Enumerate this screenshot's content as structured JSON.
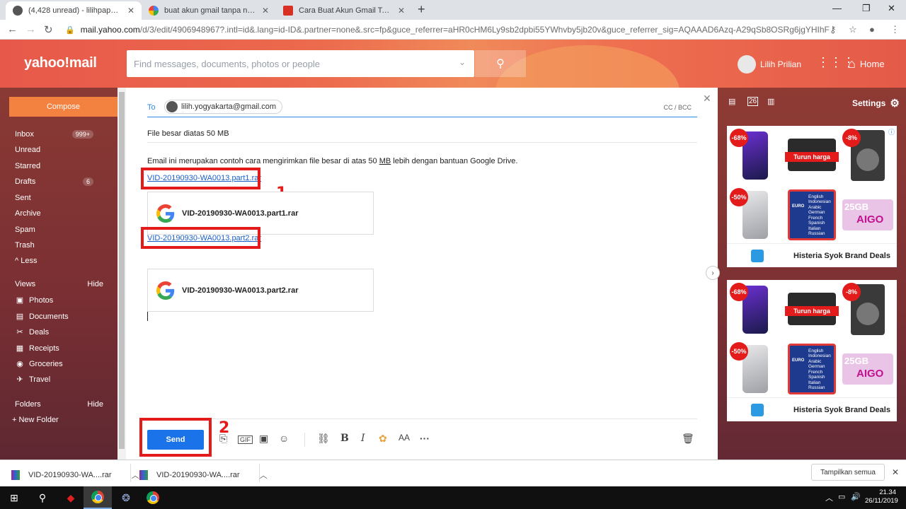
{
  "browser": {
    "tabs": [
      {
        "title": "(4,428 unread) - lilihpap@yahoo.c",
        "active": true
      },
      {
        "title": "buat akun gmail tanpa no hp - P",
        "active": false
      },
      {
        "title": "Cara Buat Akun Gmail Tanpa No",
        "active": false
      }
    ],
    "url_host": "mail.yahoo.com",
    "url_path": "/d/3/edit/4906948967?.intl=id&.lang=id-ID&.partner=none&.src=fp&guce_referrer=aHR0cHM6Ly9sb2dpbi55YWhvby5jb20v&guce_referrer_sig=AQAAAD6Azq-A29qSb8OSRg6jgYHIhFH6YDNkvn..."
  },
  "header": {
    "logo": "yahoo!mail",
    "search_placeholder": "Find messages, documents, photos or people",
    "user_name": "Lilih Prilian",
    "home_label": "Home"
  },
  "sidebar": {
    "compose_label": "Compose",
    "items": [
      {
        "label": "Inbox",
        "badge": "999+"
      },
      {
        "label": "Unread",
        "badge": ""
      },
      {
        "label": "Starred",
        "badge": ""
      },
      {
        "label": "Drafts",
        "badge": "6"
      },
      {
        "label": "Sent",
        "badge": ""
      },
      {
        "label": "Archive",
        "badge": ""
      },
      {
        "label": "Spam",
        "badge": ""
      },
      {
        "label": "Trash",
        "badge": ""
      },
      {
        "label": "Less",
        "badge": ""
      }
    ],
    "views_label": "Views",
    "views_hide": "Hide",
    "views": [
      {
        "label": "Photos",
        "icon": "photos-icon"
      },
      {
        "label": "Documents",
        "icon": "documents-icon"
      },
      {
        "label": "Deals",
        "icon": "deals-icon"
      },
      {
        "label": "Receipts",
        "icon": "receipts-icon"
      },
      {
        "label": "Groceries",
        "icon": "groceries-icon"
      },
      {
        "label": "Travel",
        "icon": "travel-icon"
      }
    ],
    "folders_label": "Folders",
    "folders_hide": "Hide",
    "new_folder": "+ New Folder"
  },
  "compose": {
    "to_label": "To",
    "recipient": "lilih.yogyakarta@gmail.com",
    "cc_bcc": "CC / BCC",
    "subject": "File besar diatas 50 MB",
    "body_pre": "Email ini merupakan contoh cara mengirimkan file besar di atas 50 ",
    "body_mb": "MB",
    "body_post": " lebih dengan bantuan Google Drive.",
    "link1": "VID-20190930-WA0013.part1.rar",
    "card1": "VID-20190930-WA0013.part1.rar",
    "link2": "VID-20190930-WA0013.part2.rar",
    "card2": "VID-20190930-WA0013.part2.rar",
    "send_label": "Send",
    "annotation_1": "1",
    "annotation_2": "2"
  },
  "rail": {
    "settings_label": "Settings",
    "ads": [
      {
        "discount_1": "-68%",
        "promo": "Turun harga",
        "discount_2": "-8%",
        "discount_3": "-50%",
        "gb": "25GB",
        "aigo": "AIGO",
        "brand": "Histeria Syok Brand Deals",
        "book_title": "EURO",
        "book_lines": [
          "English",
          "Indonesian",
          "Arabic",
          "German",
          "French",
          "Spanish",
          "Italian",
          "Russian"
        ]
      },
      {
        "discount_1": "-68%",
        "promo": "Turun harga",
        "discount_2": "-8%",
        "discount_3": "-50%",
        "gb": "25GB",
        "aigo": "AIGO",
        "brand": "Histeria Syok Brand Deals",
        "book_title": "EURO",
        "book_lines": [
          "English",
          "Indonesian",
          "Arabic",
          "German",
          "French",
          "Spanish",
          "Italian",
          "Russian"
        ]
      }
    ]
  },
  "downloads": {
    "items": [
      "VID-20190930-WA....rar",
      "VID-20190930-WA....rar"
    ],
    "show_all": "Tampilkan semua"
  },
  "taskbar": {
    "time": "21.34",
    "date": "26/11/2019"
  }
}
